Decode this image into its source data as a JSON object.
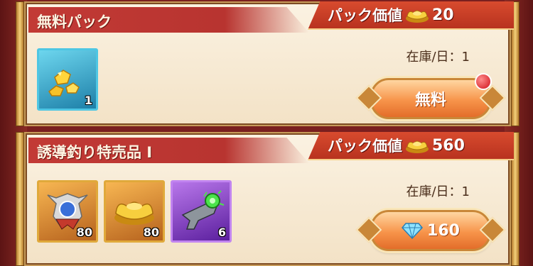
{
  "colors": {
    "banner_red": "#c23a35",
    "value_tab": "#d84b2e",
    "card_bg": "#fbf2e2",
    "button_orange": "#f7944a",
    "notification_dot": "#d0121b"
  },
  "packs": [
    {
      "title": "無料パック",
      "value_label": "パック価値",
      "value_icon": "gold-ingot-icon",
      "value": "20",
      "stock": "在庫/日：1",
      "items": [
        {
          "icon": "gold-nuggets-icon",
          "rarity": "cyan",
          "count": "1"
        }
      ],
      "button": {
        "label": "無料",
        "icon": "",
        "has_notification": true
      }
    },
    {
      "title": "誘導釣り特売品 I",
      "value_label": "パック価値",
      "value_icon": "gold-ingot-icon",
      "value": "560",
      "stock": "在庫/日：1",
      "items": [
        {
          "icon": "crest-emblem-icon",
          "rarity": "orange",
          "count": "80"
        },
        {
          "icon": "gold-ingot-icon",
          "rarity": "orange",
          "count": "80"
        },
        {
          "icon": "green-blaster-gun-icon",
          "rarity": "purple",
          "count": "6"
        }
      ],
      "button": {
        "label": "160",
        "icon": "diamond-icon",
        "has_notification": false
      }
    }
  ]
}
